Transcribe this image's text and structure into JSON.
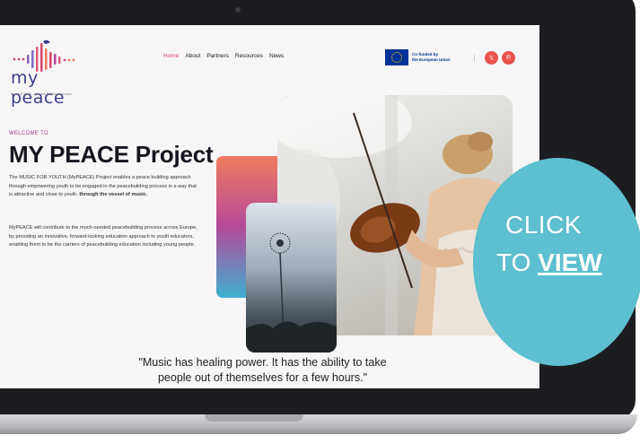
{
  "logo": {
    "text": "my peace",
    "tagline": "Music of Youth - A Peace Building Approach"
  },
  "nav": {
    "items": [
      "Home",
      "About",
      "Partners",
      "Resources",
      "News"
    ],
    "active": "Home"
  },
  "eu_badge": {
    "line1": "Co-funded by",
    "line2": "the European Union"
  },
  "social": {
    "icon1": "x-icon",
    "icon2": "pinterest-icon",
    "glyph1": "𝕏",
    "glyph2": "℗"
  },
  "hero": {
    "welcome": "WELCOME TO",
    "title": "MY PEACE Project",
    "para1_start": "The MUSIC FOR YOUTH (MyPEACE) Project enables a peace building approach through empowering youth to be engaged in the peacebuilding process in a way that is attractive and close to youth, ",
    "para1_bold": "through the vessel of music.",
    "para2": "MyPEACE will contribute to the much-needed peacebuilding process across Europe, by providing an innovative, forward-looking education approach to youth educators, enabling them to be the carriers of peacebuilding education including young people."
  },
  "quote": {
    "line1": "\"Music has healing power. It has the ability to take",
    "line2": "people out of themselves for a few hours.\""
  },
  "cta": {
    "line1": "CLICK",
    "to": "TO ",
    "view": "VIEW"
  },
  "colors": {
    "accent": "#d8476b",
    "cta": "#5dbfcf",
    "logo": "#3a3f8a"
  }
}
